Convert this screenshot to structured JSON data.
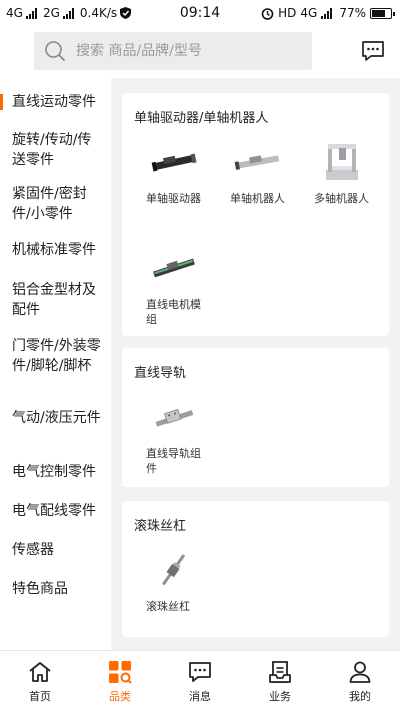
{
  "status_bar": {
    "left_text": "4G",
    "left_text2": "2G",
    "speed": "0.4K/s",
    "time": "09:14",
    "hd": "HD",
    "net": "4G",
    "battery": "77%"
  },
  "search": {
    "placeholder": "搜索 商品/品牌/型号"
  },
  "sidebar": {
    "items": [
      {
        "label": "直线运动零件"
      },
      {
        "label": "旋转/传动/传送零件"
      },
      {
        "label": "紧固件/密封件/小零件"
      },
      {
        "label": "机械标准零件"
      },
      {
        "label": "铝合金型材及配件"
      },
      {
        "label": "门零件/外装零件/脚轮/脚杯"
      },
      {
        "label": "气动/液压元件"
      },
      {
        "label": "电气控制零件"
      },
      {
        "label": "电气配线零件"
      },
      {
        "label": "传感器"
      },
      {
        "label": "特色商品"
      }
    ]
  },
  "sections": [
    {
      "title": "单轴驱动器/单轴机器人",
      "products": [
        {
          "name": "单轴驱动器",
          "icon": "single-axis-driver-image"
        },
        {
          "name": "单轴机器人",
          "icon": "single-axis-robot-image"
        },
        {
          "name": "多轴机器人",
          "icon": "multi-axis-robot-image"
        },
        {
          "name": "直线电机模组",
          "icon": "linear-motor-module-image"
        }
      ]
    },
    {
      "title": "直线导轨",
      "products": [
        {
          "name": "直线导轨组件",
          "icon": "linear-guide-image"
        }
      ]
    },
    {
      "title": "滚珠丝杠",
      "products": [
        {
          "name": "滚珠丝杠",
          "icon": "ball-screw-image"
        }
      ]
    }
  ],
  "tabbar": {
    "items": [
      {
        "label": "首页",
        "icon": "home-icon"
      },
      {
        "label": "品类",
        "icon": "category-icon"
      },
      {
        "label": "消息",
        "icon": "message-icon"
      },
      {
        "label": "业务",
        "icon": "business-icon"
      },
      {
        "label": "我的",
        "icon": "user-icon"
      }
    ]
  },
  "colors": {
    "accent": "#ff6a00",
    "content_bg": "#f2f2f2",
    "search_bg": "#ececec"
  }
}
